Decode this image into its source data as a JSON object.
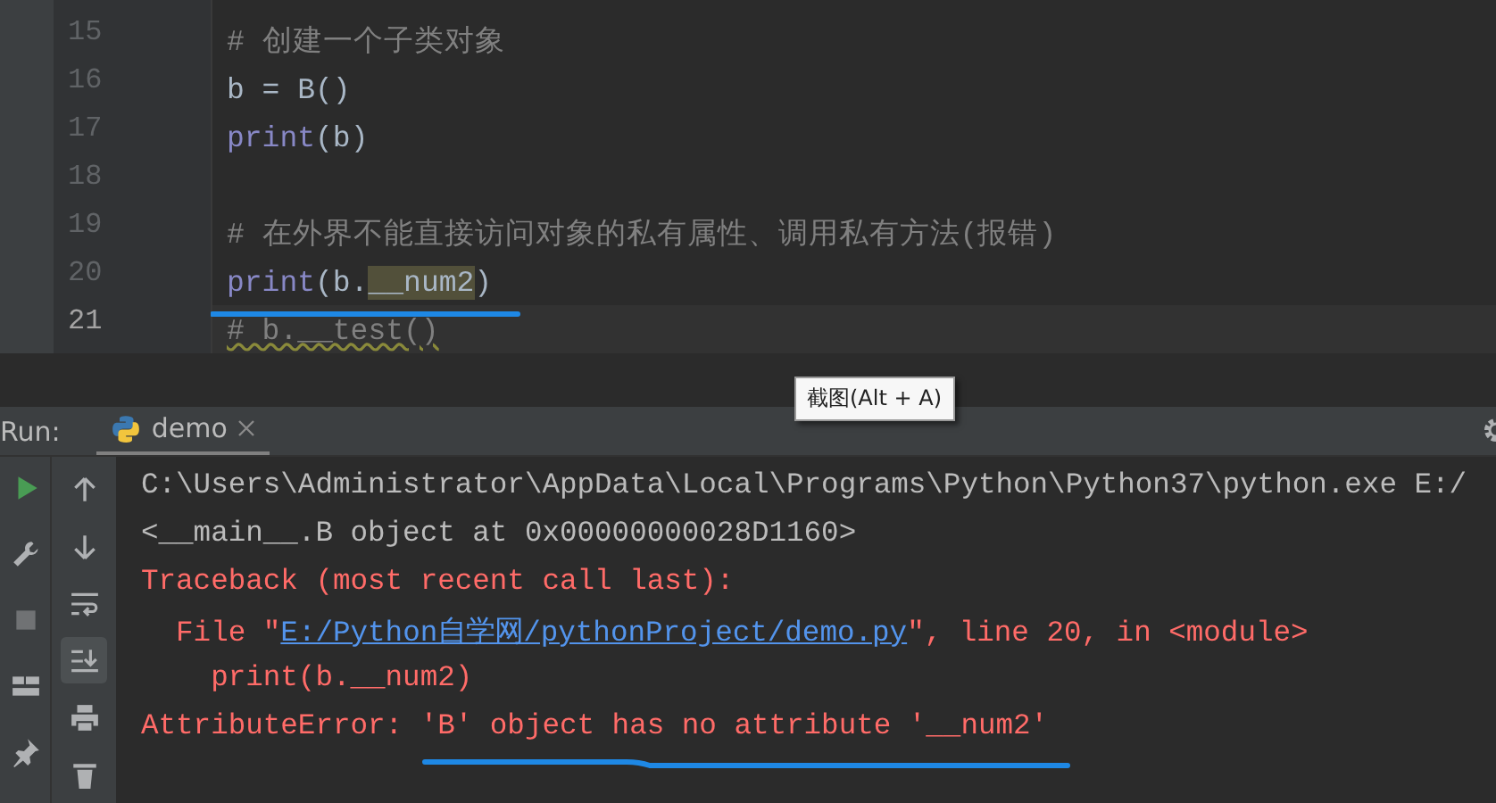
{
  "editor": {
    "lines": [
      {
        "number": "15",
        "current": false,
        "segments": [
          {
            "text": "# 创建一个子类对象",
            "kind": "comment"
          }
        ]
      },
      {
        "number": "16",
        "current": false,
        "segments": [
          {
            "text": "b = B()",
            "kind": "plain"
          }
        ]
      },
      {
        "number": "17",
        "current": false,
        "segments": [
          {
            "text": "print",
            "kind": "builtin"
          },
          {
            "text": "(b)",
            "kind": "plain"
          }
        ]
      },
      {
        "number": "18",
        "current": false
      },
      {
        "number": "19",
        "current": false,
        "segments": [
          {
            "text": "# 在外界不能直接访问对象的私有属性、调用私有方法(报错)",
            "kind": "comment"
          }
        ]
      },
      {
        "number": "20",
        "current": false,
        "segments": [
          {
            "text": "print",
            "kind": "builtin"
          },
          {
            "text": "(b.",
            "kind": "plain"
          },
          {
            "text": "__num2",
            "kind": "highlight"
          },
          {
            "text": ")",
            "kind": "plain"
          }
        ]
      },
      {
        "number": "21",
        "current": true,
        "segments": [
          {
            "text": "# b.__test()",
            "kind": "warning"
          }
        ]
      }
    ]
  },
  "tooltip": "截图(Alt + A)",
  "run_bar": {
    "label": "Run:",
    "tabs": [
      {
        "label": "demo",
        "selected": true
      }
    ]
  },
  "run_toolbar": [
    {
      "kind": "rerun",
      "disabled": false
    },
    {
      "kind": "settings",
      "disabled": false
    },
    {
      "kind": "stop",
      "disabled": true
    },
    {
      "kind": "layout",
      "disabled": false
    },
    {
      "kind": "pin",
      "disabled": false
    }
  ],
  "console_toolbar": [
    {
      "kind": "up",
      "selected": false
    },
    {
      "kind": "down",
      "selected": false
    },
    {
      "kind": "wrap",
      "selected": false
    },
    {
      "kind": "scroll-end",
      "selected": true
    },
    {
      "kind": "print",
      "selected": false
    },
    {
      "kind": "delete",
      "selected": false
    }
  ],
  "console": {
    "lines": [
      {
        "kind": "stdout",
        "segments": [
          {
            "text": "C:\\Users\\Administrator\\AppData\\Local\\Programs\\Python\\Python37\\python.exe E:/",
            "kind": "plain"
          }
        ]
      },
      {
        "kind": "stdout",
        "segments": [
          {
            "text": "<__main__.B object at 0x00000000028D1160>",
            "kind": "plain"
          }
        ]
      },
      {
        "kind": "error",
        "segments": [
          {
            "text": "Traceback (most recent call last):",
            "kind": "plain"
          }
        ]
      },
      {
        "kind": "error",
        "segments": [
          {
            "text": "  File \"",
            "kind": "plain"
          },
          {
            "text": "E:/Python自学网/pythonProject/demo.py",
            "kind": "link"
          },
          {
            "text": "\", line 20, in <module>",
            "kind": "plain"
          }
        ]
      },
      {
        "kind": "error",
        "segments": [
          {
            "text": "    print(b.__num2)",
            "kind": "plain"
          }
        ]
      },
      {
        "kind": "error",
        "segments": [
          {
            "text": "AttributeError: 'B' object has no attribute '__num2'",
            "kind": "plain"
          }
        ]
      }
    ]
  }
}
